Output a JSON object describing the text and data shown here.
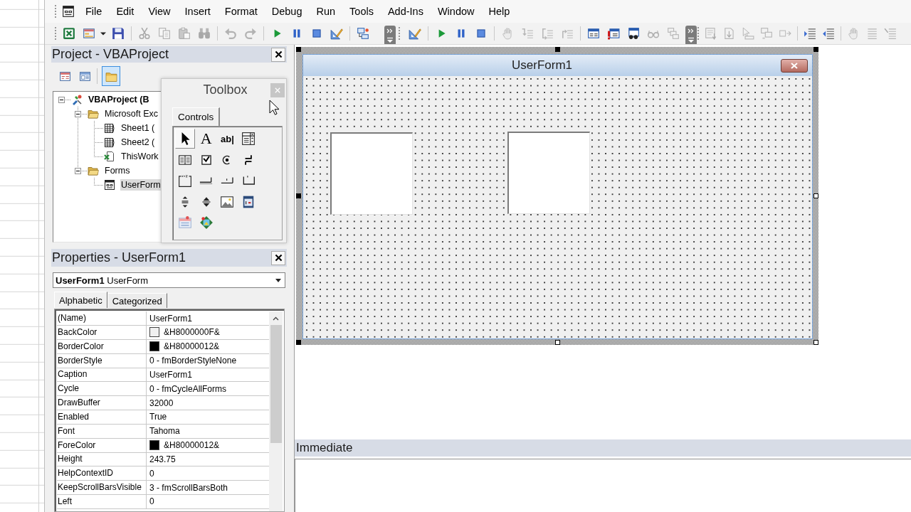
{
  "menu": [
    "File",
    "Edit",
    "View",
    "Insert",
    "Format",
    "Debug",
    "Run",
    "Tools",
    "Add-Ins",
    "Window",
    "Help"
  ],
  "toolbars": [
    {
      "groups": [
        [
          {
            "kind": "excel",
            "disabled": false
          },
          {
            "kind": "form",
            "disabled": false
          },
          {
            "kind": "dropdown",
            "disabled": false
          },
          {
            "kind": "save",
            "disabled": false
          }
        ],
        [
          {
            "kind": "cut",
            "disabled": true
          },
          {
            "kind": "copy",
            "disabled": true
          },
          {
            "kind": "paste",
            "disabled": true
          },
          {
            "kind": "find",
            "disabled": true
          }
        ],
        [
          {
            "kind": "undo",
            "disabled": true
          },
          {
            "kind": "redo",
            "disabled": true
          }
        ],
        [
          {
            "kind": "run",
            "disabled": false
          },
          {
            "kind": "pause",
            "disabled": false
          },
          {
            "kind": "stop",
            "disabled": false
          },
          {
            "kind": "design",
            "disabled": false
          }
        ],
        [
          {
            "kind": "explorer",
            "disabled": false
          }
        ]
      ],
      "overflow": true
    },
    {
      "groups": [
        [
          {
            "kind": "design",
            "disabled": false
          }
        ],
        [
          {
            "kind": "run",
            "disabled": false
          },
          {
            "kind": "pause",
            "disabled": false
          },
          {
            "kind": "stop",
            "disabled": false
          }
        ],
        [
          {
            "kind": "hand",
            "disabled": true
          },
          {
            "kind": "stepinto",
            "disabled": true
          },
          {
            "kind": "stepover",
            "disabled": true
          },
          {
            "kind": "stepout",
            "disabled": true
          }
        ],
        [
          {
            "kind": "locals",
            "disabled": false
          },
          {
            "kind": "immediate",
            "disabled": false
          },
          {
            "kind": "watch",
            "disabled": false
          },
          {
            "kind": "quickwatch",
            "disabled": true
          },
          {
            "kind": "callstack",
            "disabled": true
          }
        ]
      ],
      "overflow": true
    },
    {
      "groups": [
        [
          {
            "kind": "listprops",
            "disabled": true
          },
          {
            "kind": "listconsts",
            "disabled": true
          },
          {
            "kind": "quickinfo",
            "disabled": true
          },
          {
            "kind": "paraminfo",
            "disabled": true
          },
          {
            "kind": "complete",
            "disabled": true
          }
        ],
        [
          {
            "kind": "indent",
            "disabled": false
          },
          {
            "kind": "outdent",
            "disabled": false
          }
        ],
        [
          {
            "kind": "hand",
            "disabled": true
          },
          {
            "kind": "comment",
            "disabled": true
          },
          {
            "kind": "uncomment",
            "disabled": true
          }
        ]
      ]
    }
  ],
  "project": {
    "title": "Project - VBAProject",
    "toolbar": [
      {
        "kind": "code",
        "selected": false
      },
      {
        "kind": "object",
        "selected": false
      },
      {
        "kind": "folders",
        "selected": true
      }
    ],
    "tree": [
      {
        "label": "VBAProject (B",
        "kind": "project",
        "expanded": true,
        "selected": false,
        "children": [
          {
            "label": "Microsoft Exc",
            "kind": "folder",
            "expanded": true,
            "selected": false,
            "children": [
              {
                "label": "Sheet1 (",
                "kind": "sheet",
                "selected": false
              },
              {
                "label": "Sheet2 (",
                "kind": "sheet",
                "selected": false
              },
              {
                "label": "ThisWork",
                "kind": "workbook",
                "selected": false
              }
            ]
          },
          {
            "label": "Forms",
            "kind": "folder",
            "expanded": true,
            "selected": false,
            "children": [
              {
                "label": "UserForm",
                "kind": "form",
                "selected": true
              }
            ]
          }
        ]
      }
    ]
  },
  "toolbox": {
    "title": "Toolbox",
    "tabs": [
      {
        "label": "Controls",
        "selected": true
      }
    ],
    "tools": [
      {
        "kind": "pointer",
        "selected": true
      },
      {
        "kind": "label",
        "glyph": "A",
        "selected": false
      },
      {
        "kind": "textbox",
        "glyph": "ab|",
        "selected": false
      },
      {
        "kind": "combobox",
        "selected": false
      },
      {
        "kind": "listbox",
        "selected": false
      },
      {
        "kind": "checkbox",
        "selected": false
      },
      {
        "kind": "option",
        "selected": false
      },
      {
        "kind": "toggle",
        "selected": false
      },
      {
        "kind": "frame",
        "selected": false
      },
      {
        "kind": "command",
        "selected": false
      },
      {
        "kind": "tabstrip",
        "selected": false
      },
      {
        "kind": "multipage",
        "selected": false
      },
      {
        "kind": "scrollbar",
        "selected": false
      },
      {
        "kind": "spin",
        "selected": false
      },
      {
        "kind": "image",
        "selected": false
      },
      {
        "kind": "refedit",
        "selected": false
      },
      {
        "kind": "addon",
        "selected": false
      },
      {
        "kind": "gallery",
        "selected": false
      }
    ]
  },
  "properties": {
    "title": "Properties - UserForm1",
    "object": "**UserForm1** UserForm",
    "tabs": [
      {
        "label": "Alphabetic",
        "selected": true
      },
      {
        "label": "Categorized",
        "selected": false
      }
    ],
    "rows": [
      {
        "name": "(Name)",
        "value": "UserForm1"
      },
      {
        "name": "BackColor",
        "value": "&H8000000F&",
        "color": "#f0f0f0"
      },
      {
        "name": "BorderColor",
        "value": "&H80000012&",
        "color": "#000000"
      },
      {
        "name": "BorderStyle",
        "value": "0 - fmBorderStyleNone"
      },
      {
        "name": "Caption",
        "value": "UserForm1"
      },
      {
        "name": "Cycle",
        "value": "0 - fmCycleAllForms"
      },
      {
        "name": "DrawBuffer",
        "value": "32000"
      },
      {
        "name": "Enabled",
        "value": "True"
      },
      {
        "name": "Font",
        "value": "Tahoma"
      },
      {
        "name": "ForeColor",
        "value": "&H80000012&",
        "color": "#000000"
      },
      {
        "name": "Height",
        "value": "243.75"
      },
      {
        "name": "HelpContextID",
        "value": "0"
      },
      {
        "name": "KeepScrollBarsVisible",
        "value": "3 - fmScrollBarsBoth"
      },
      {
        "name": "Left",
        "value": "0"
      }
    ]
  },
  "designer": {
    "form": {
      "title": "UserForm1",
      "controls": [
        {
          "kind": "image"
        },
        {
          "kind": "image"
        }
      ]
    },
    "handles": [
      {
        "resizable": false
      },
      {
        "resizable": false
      },
      {
        "resizable": false
      },
      {
        "resizable": false
      },
      {
        "resizable": true
      },
      {
        "resizable": false
      },
      {
        "resizable": true
      },
      {
        "resizable": true
      }
    ]
  },
  "immediate": {
    "title": "Immediate"
  }
}
